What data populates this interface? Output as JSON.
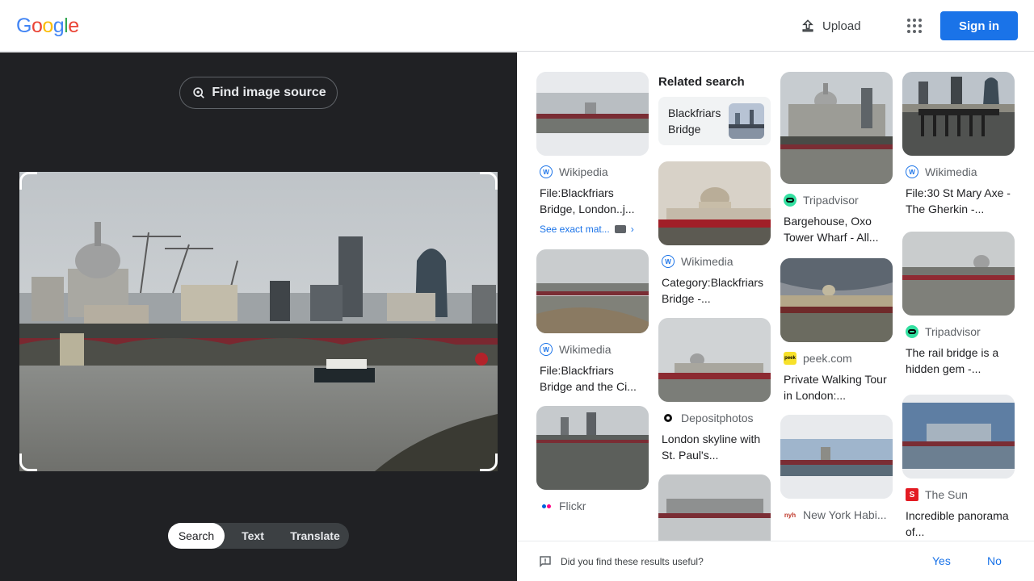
{
  "header": {
    "logo_letters": [
      {
        "ch": "G",
        "color": "#4285F4"
      },
      {
        "ch": "o",
        "color": "#EA4335"
      },
      {
        "ch": "o",
        "color": "#FBBC05"
      },
      {
        "ch": "g",
        "color": "#4285F4"
      },
      {
        "ch": "l",
        "color": "#34A853"
      },
      {
        "ch": "e",
        "color": "#EA4335"
      }
    ],
    "upload_label": "Upload",
    "apps_icon": "apps-grid-icon",
    "signin_label": "Sign in"
  },
  "left_panel": {
    "find_source_label": "Find image source",
    "tabs": [
      "Search",
      "Text",
      "Translate"
    ],
    "active_tab": "Search"
  },
  "results": {
    "related_heading": "Related search",
    "related_chip": "Blackfriars Bridge",
    "see_exact_label": "See exact mat...",
    "items": {
      "c1_1": {
        "source": "Wikipedia",
        "title": "File:Blackfriars Bridge, London..j..."
      },
      "c1_2": {
        "source": "Wikimedia",
        "title": "File:Blackfriars Bridge and the Ci..."
      },
      "c1_3": {
        "source": "Flickr",
        "title": ""
      },
      "c2_1": {
        "source": "Wikimedia",
        "title": "Category:Blackfriars Bridge -..."
      },
      "c2_2": {
        "source": "Depositphotos",
        "title": "London skyline with St. Paul's..."
      },
      "c3_1": {
        "source": "Tripadvisor",
        "title": "Bargehouse, Oxo Tower Wharf - All..."
      },
      "c3_2": {
        "source": "peek.com",
        "title": "Private Walking Tour in London:..."
      },
      "c3_3": {
        "source": "New York Habi...",
        "title": ""
      },
      "c4_1": {
        "source": "Wikimedia",
        "title": "File:30 St Mary Axe - The Gherkin -..."
      },
      "c4_2": {
        "source": "Tripadvisor",
        "title": "The rail bridge is a hidden gem -..."
      },
      "c4_3": {
        "source": "The Sun",
        "title": "Incredible panorama of..."
      }
    }
  },
  "feedback": {
    "question": "Did you find these results useful?",
    "yes": "Yes",
    "no": "No"
  }
}
